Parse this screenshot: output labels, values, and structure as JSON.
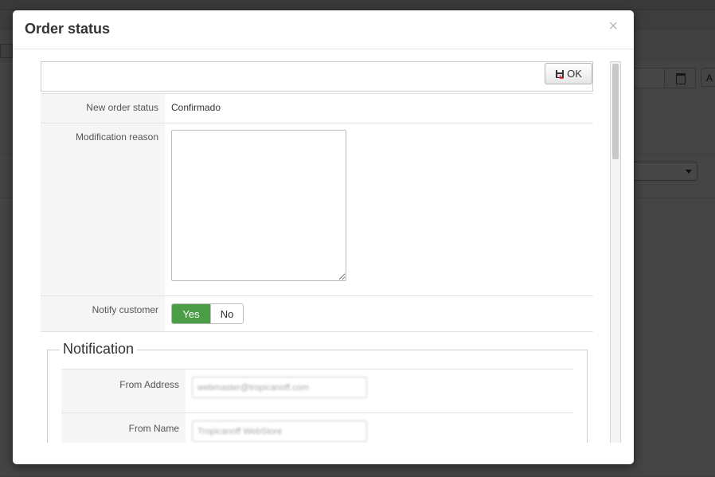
{
  "modal": {
    "title": "Order status",
    "close_symbol": "×",
    "ok_label": "OK"
  },
  "form": {
    "status_label": "New order status",
    "status_value": "Confirmado",
    "reason_label": "Modification reason",
    "reason_value": "",
    "notify_label": "Notify customer",
    "notify_yes": "Yes",
    "notify_no": "No"
  },
  "notification": {
    "legend": "Notification",
    "from_address_label": "From Address",
    "from_address_value": "webmaster@tropicanoff.com",
    "from_name_label": "From Name",
    "from_name_value": "Tropicanoff WebStore"
  },
  "background": {
    "button_letter": "A"
  },
  "colors": {
    "yes_active": "#4c9d48",
    "overlay": "rgba(0,0,0,0.72)"
  }
}
